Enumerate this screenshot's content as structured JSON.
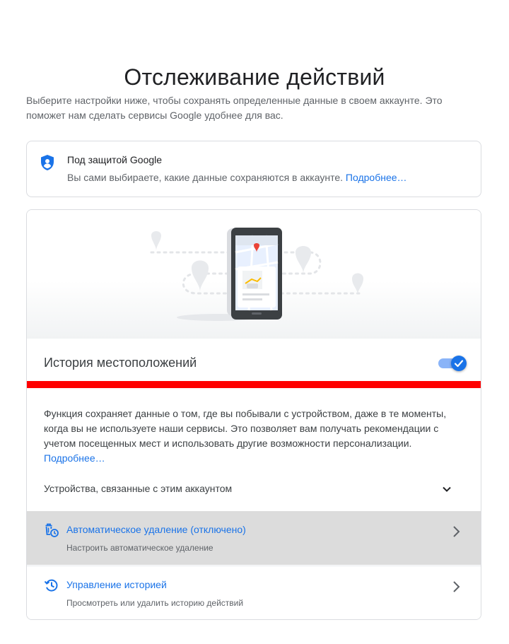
{
  "page": {
    "title": "Отслеживание действий",
    "description": "Выберите настройки ниже, чтобы сохранять определенные данные в своем аккаунте. Это поможет нам сделать сервисы Google удобнее для вас."
  },
  "protection": {
    "icon": "shield-person-icon",
    "title": "Под защитой Google",
    "text": "Вы сами выбираете, какие данные сохраняются в аккаунте.",
    "link": "Подробнее…"
  },
  "location_history": {
    "title": "История местоположений",
    "toggle_on": true,
    "description": "Функция сохраняет данные о том, где вы побывали с устройством, даже в те моменты, когда вы не используете наши сервисы. Это позволяет вам получать рекомендации с учетом посещенных мест и использовать другие возможности персонализации.",
    "link": "Подробнее…",
    "devices_label": "Устройства, связанные с этим аккаунтом"
  },
  "actions": [
    {
      "icon": "auto-delete-icon",
      "title": "Автоматическое удаление (отключено)",
      "subtitle": "Настроить автоматическое удаление"
    },
    {
      "icon": "history-icon",
      "title": "Управление историей",
      "subtitle": "Просмотреть или удалить историю действий"
    }
  ],
  "colors": {
    "accent": "#1a73e8",
    "highlight_bar": "#ff0000",
    "selected_row": "#dcdcdc"
  }
}
